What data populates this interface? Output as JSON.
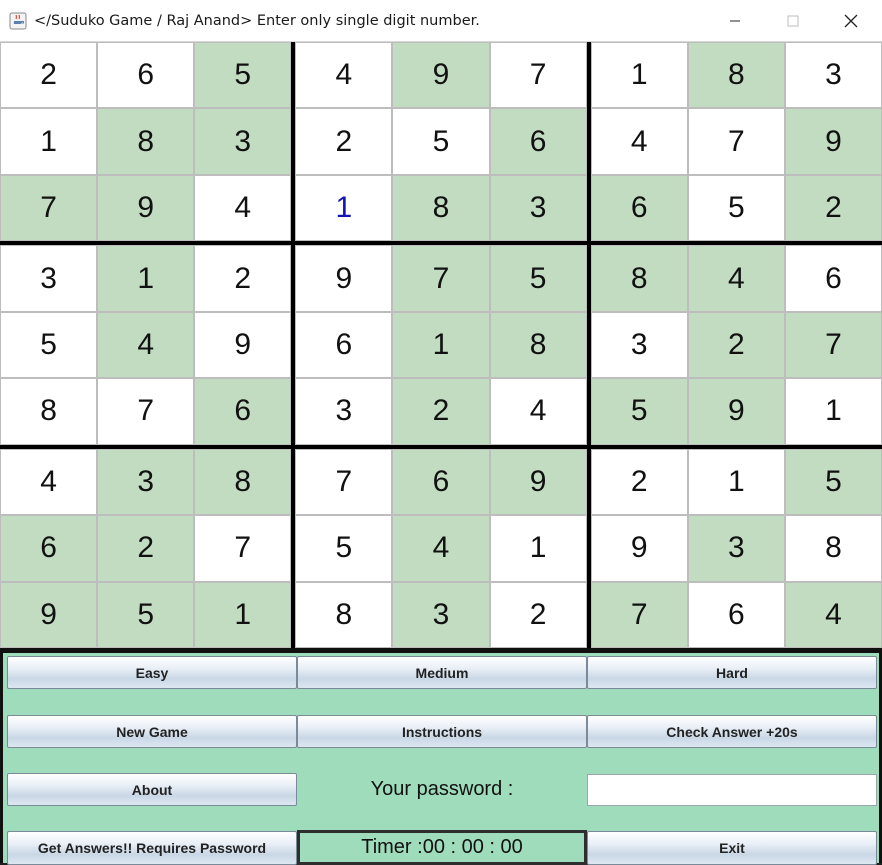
{
  "window": {
    "title": "</Suduko Game / Raj Anand> Enter only single digit number."
  },
  "board": {
    "rows": [
      [
        "2",
        "6",
        "5",
        "4",
        "9",
        "7",
        "1",
        "8",
        "3"
      ],
      [
        "1",
        "8",
        "3",
        "2",
        "5",
        "6",
        "4",
        "7",
        "9"
      ],
      [
        "7",
        "9",
        "4",
        "1",
        "8",
        "3",
        "6",
        "5",
        "2"
      ],
      [
        "3",
        "1",
        "2",
        "9",
        "7",
        "5",
        "8",
        "4",
        "6"
      ],
      [
        "5",
        "4",
        "9",
        "6",
        "1",
        "8",
        "3",
        "2",
        "7"
      ],
      [
        "8",
        "7",
        "6",
        "3",
        "2",
        "4",
        "5",
        "9",
        "1"
      ],
      [
        "4",
        "3",
        "8",
        "7",
        "6",
        "9",
        "2",
        "1",
        "5"
      ],
      [
        "6",
        "2",
        "7",
        "5",
        "4",
        "1",
        "9",
        "3",
        "8"
      ],
      [
        "9",
        "5",
        "1",
        "8",
        "3",
        "2",
        "7",
        "6",
        "4"
      ]
    ],
    "prefilled": [
      [
        0,
        0,
        1,
        0,
        1,
        0,
        0,
        1,
        0
      ],
      [
        0,
        1,
        1,
        0,
        0,
        1,
        0,
        0,
        1
      ],
      [
        1,
        1,
        0,
        0,
        1,
        1,
        1,
        0,
        1
      ],
      [
        0,
        1,
        0,
        0,
        1,
        1,
        1,
        1,
        0
      ],
      [
        0,
        1,
        0,
        0,
        1,
        1,
        0,
        1,
        1
      ],
      [
        0,
        0,
        1,
        0,
        1,
        0,
        1,
        1,
        0
      ],
      [
        0,
        1,
        1,
        0,
        1,
        1,
        0,
        0,
        1
      ],
      [
        1,
        1,
        0,
        0,
        1,
        0,
        0,
        1,
        0
      ],
      [
        1,
        1,
        1,
        0,
        1,
        0,
        1,
        0,
        1
      ]
    ],
    "user_entered_cells": [
      [
        2,
        3
      ]
    ],
    "colors": {
      "prefilled_bg": "#c2dcc2",
      "empty_bg": "#ffffff",
      "user_digit": "#1414b4",
      "panel_bg": "#9fdcbc"
    }
  },
  "controls": {
    "easy": "Easy",
    "medium": "Medium",
    "hard": "Hard",
    "new_game": "New Game",
    "instructions": "Instructions",
    "check_answer": "Check Answer +20s",
    "about": "About",
    "password_label": "Your password :",
    "password_value": "",
    "get_answers": "Get Answers!! Requires Password",
    "timer": "Timer :00 : 00 : 00",
    "exit": "Exit"
  },
  "icons": {
    "app": "java-coffee-icon",
    "minimize": "minimize-icon",
    "maximize": "maximize-icon",
    "close": "close-icon"
  }
}
